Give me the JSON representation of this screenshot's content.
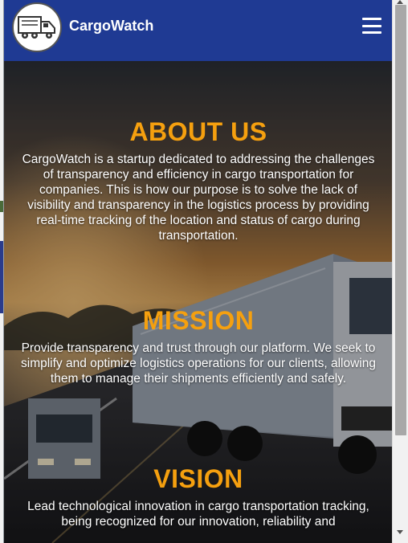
{
  "navbar": {
    "brand": "CargoWatch",
    "logo_icon": "truck-icon",
    "menu_icon": "hamburger-menu-icon",
    "background_color": "#1f3a93"
  },
  "sections": {
    "about": {
      "title": "ABOUT US",
      "text": "CargoWatch is a startup dedicated to addressing the challenges of transparency and efficiency in cargo transportation for companies. This is how our purpose is to solve the lack of visibility and transparency in the logistics process by providing real-time tracking of the location and status of cargo during transportation."
    },
    "mission": {
      "title": "MISSION",
      "text": "Provide transparency and trust through our platform. We seek to simplify and optimize logistics operations for our clients, allowing them to manage their shipments efficiently and safely."
    },
    "vision": {
      "title": "VISION",
      "text": "Lead technological innovation in cargo transportation tracking, being recognized for our innovation, reliability and"
    }
  },
  "colors": {
    "accent": "#f5a00f",
    "text": "#ffffff"
  }
}
